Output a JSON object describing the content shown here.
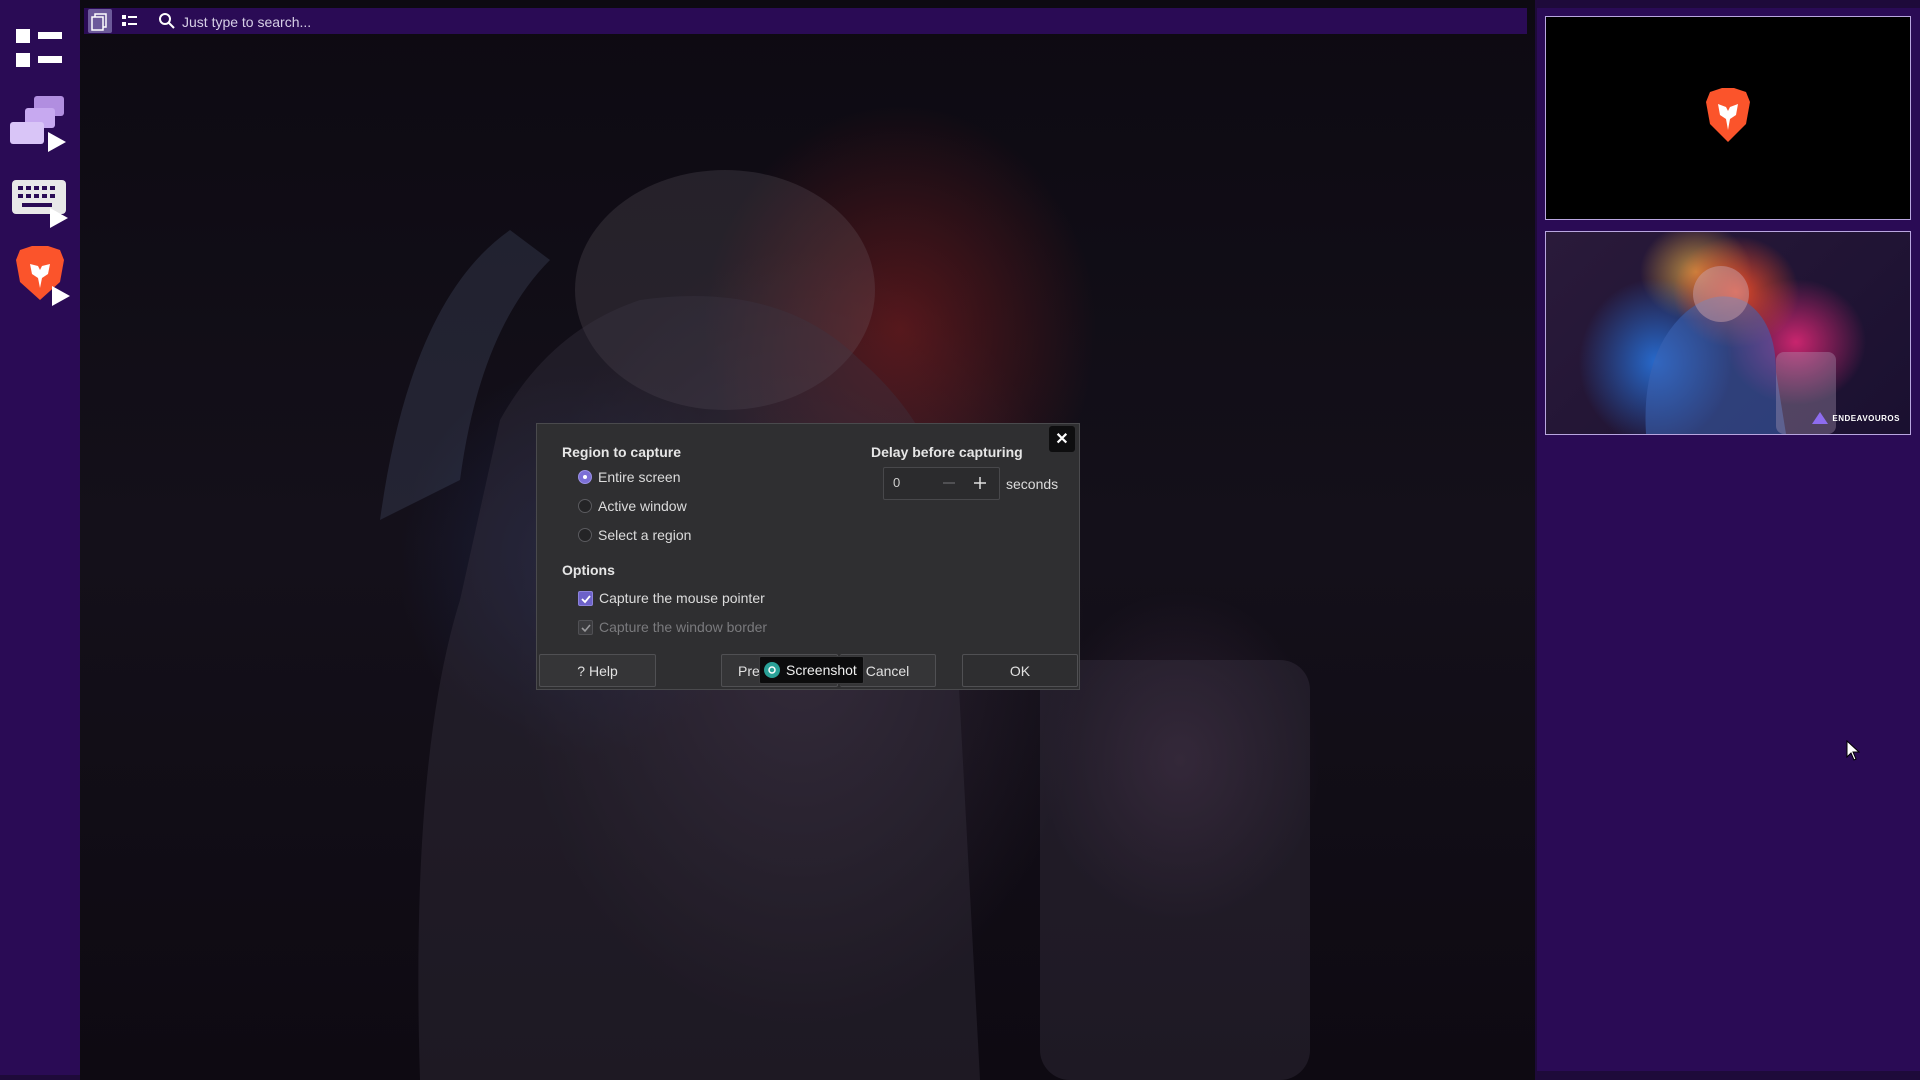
{
  "search": {
    "placeholder": "Just type to search..."
  },
  "dock": {
    "items": [
      {
        "name": "app-menu-icon"
      },
      {
        "name": "window-switcher-icon"
      },
      {
        "name": "keyboard-launcher-icon"
      },
      {
        "name": "brave-browser-icon"
      }
    ]
  },
  "dialog": {
    "region_title": "Region to capture",
    "region_options": [
      "Entire screen",
      "Active window",
      "Select a region"
    ],
    "region_selected": "Entire screen",
    "options_title": "Options",
    "capture_pointer_label": "Capture the mouse pointer",
    "capture_pointer_checked": true,
    "capture_border_label": "Capture the window border",
    "capture_border_checked": true,
    "capture_border_enabled": false,
    "delay_title": "Delay before capturing",
    "delay_value": "0",
    "seconds_label": "seconds",
    "help_label": "Help",
    "preferences_label_partial": "Pre",
    "cancel_label": "Cancel",
    "ok_label": "OK"
  },
  "tooltip": {
    "label": "Screenshot"
  },
  "right_panel": {
    "wallpaper_brand": "ENDEAVOUROS"
  },
  "colors": {
    "panel": "#2a0b55",
    "accent": "#7b6fd6",
    "dialog_bg": "#2f2f31"
  }
}
